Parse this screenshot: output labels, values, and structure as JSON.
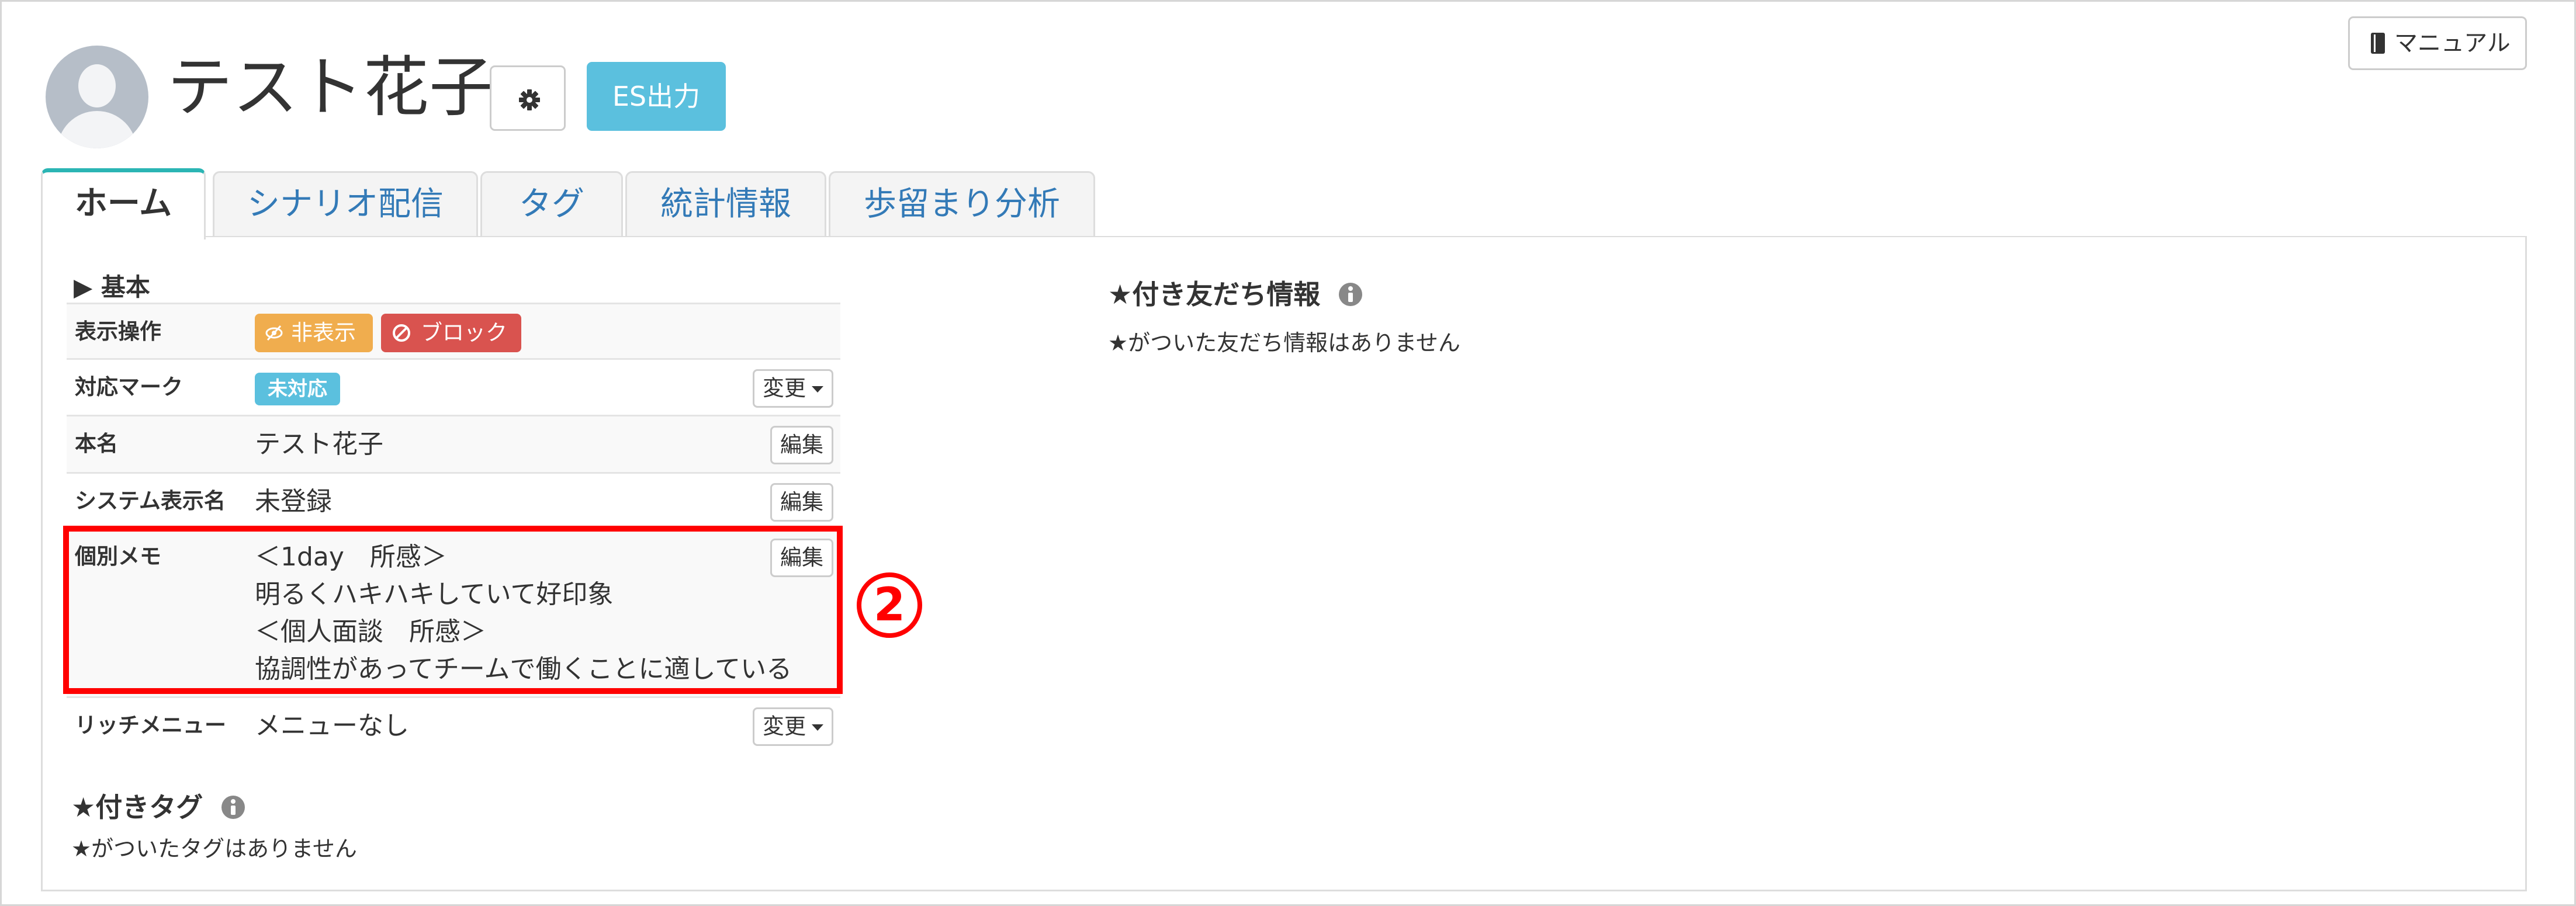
{
  "profile": {
    "name": "テスト花子",
    "es_button": "ES出力"
  },
  "manual": {
    "label": "マニュアル"
  },
  "tabs": [
    {
      "label": "ホーム",
      "active": true
    },
    {
      "label": "シナリオ配信",
      "active": false
    },
    {
      "label": "タグ",
      "active": false
    },
    {
      "label": "統計情報",
      "active": false
    },
    {
      "label": "歩留まり分析",
      "active": false
    }
  ],
  "basic": {
    "heading": "▶ 基本",
    "display_ops": {
      "label": "表示操作",
      "hide_button": "非表示",
      "block_button": "ブロック"
    },
    "status_mark": {
      "label": "対応マーク",
      "value": "未対応",
      "change_button": "変更"
    },
    "real_name": {
      "label": "本名",
      "value": "テスト花子",
      "edit_button": "編集"
    },
    "system_name": {
      "label": "システム表示名",
      "value": "未登録",
      "edit_button": "編集"
    },
    "memo": {
      "label": "個別メモ",
      "lines": [
        "＜1day　所感＞",
        "明るくハキハキしていて好印象",
        "＜個人面談　所感＞",
        "協調性があってチームで働くことに適している"
      ],
      "edit_button": "編集"
    },
    "rich_menu": {
      "label": "リッチメニュー",
      "value": "メニューなし",
      "change_button": "変更"
    }
  },
  "annotation": {
    "marker": "②",
    "color": "#ff0000"
  },
  "star_tags": {
    "heading": "★付きタグ",
    "empty": "★がついたタグはありません"
  },
  "star_friends": {
    "heading": "★付き友だち情報",
    "empty": "★がついた友だち情報はありません"
  },
  "colors": {
    "es_button": "#5bc0de",
    "hide_button": "#f0ad4e",
    "block_button": "#d9534f",
    "status_label": "#5bc0de",
    "active_tab_accent": "#2bb5b4",
    "link": "#337ab7"
  },
  "icons": {
    "gear": "gear-icon",
    "manual": "book-icon",
    "hide": "eye-slash-icon",
    "block": "ban-icon",
    "info": "info-circle-icon"
  }
}
